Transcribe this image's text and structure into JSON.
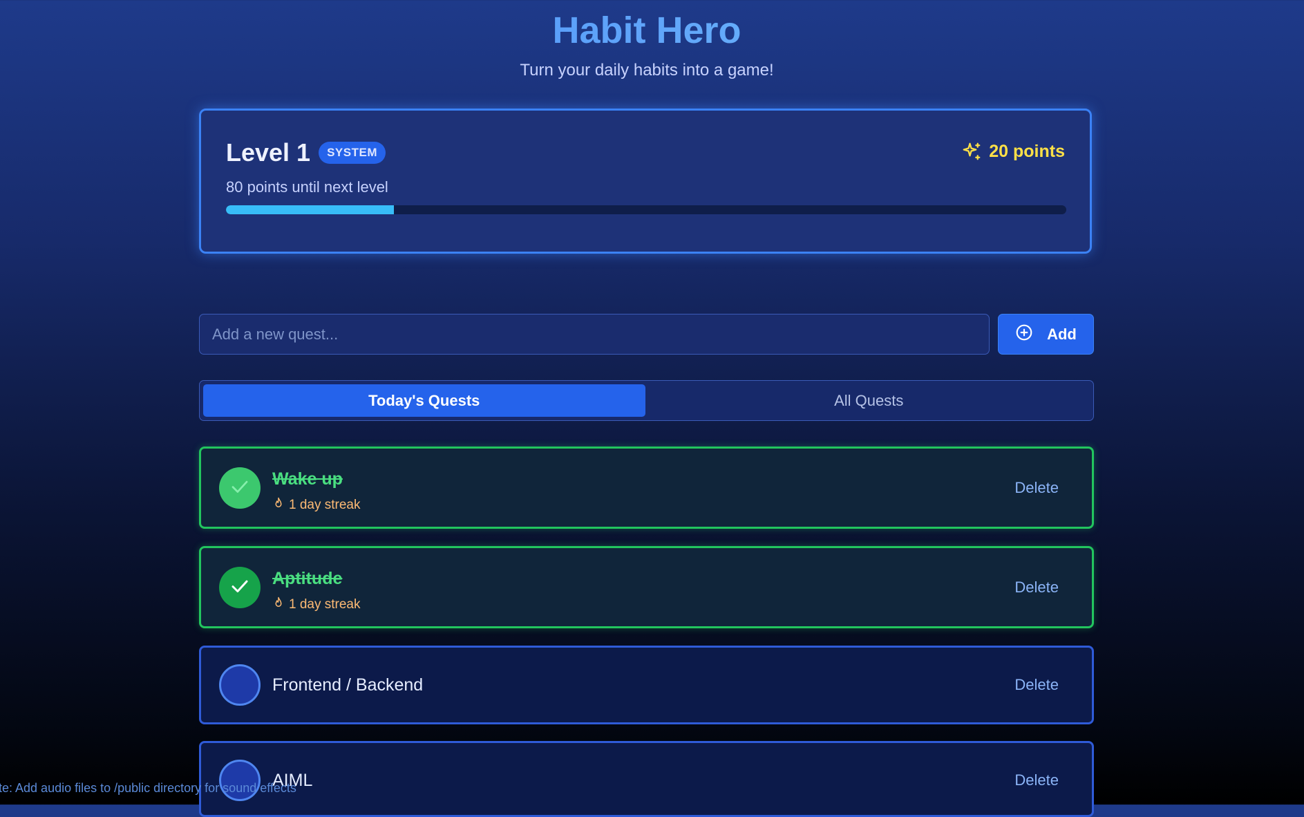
{
  "header": {
    "title": "Habit Hero",
    "subtitle": "Turn your daily habits into a game!"
  },
  "level_card": {
    "level_label": "Level 1",
    "badge": "SYSTEM",
    "points_label": "20 points",
    "next_level_text": "80 points until next level",
    "progress_fraction": 0.2,
    "points_icon": "sparkles-icon",
    "colors": {
      "accent": "#3b82f6",
      "points": "#fde047",
      "progress": "#38bdf8"
    }
  },
  "add_quest": {
    "placeholder": "Add a new quest...",
    "value": "",
    "button_label": "Add",
    "button_icon": "plus-circle-icon"
  },
  "tabs": [
    {
      "label": "Today's Quests",
      "active": true
    },
    {
      "label": "All Quests",
      "active": false
    }
  ],
  "quests": [
    {
      "title": "Wake up",
      "completed": true,
      "streak": "1 day streak",
      "delete_label": "Delete"
    },
    {
      "title": "Aptitude",
      "completed": true,
      "streak": "1 day streak",
      "delete_label": "Delete"
    },
    {
      "title": "Frontend / Backend",
      "completed": false,
      "delete_label": "Delete"
    },
    {
      "title": "AIML",
      "completed": false,
      "delete_label": "Delete"
    }
  ],
  "footer_note": "ote: Add audio files to /public directory for sound effects",
  "colors": {
    "completed": "#22c55e",
    "streak": "#fdba74",
    "primary": "#2563eb"
  }
}
